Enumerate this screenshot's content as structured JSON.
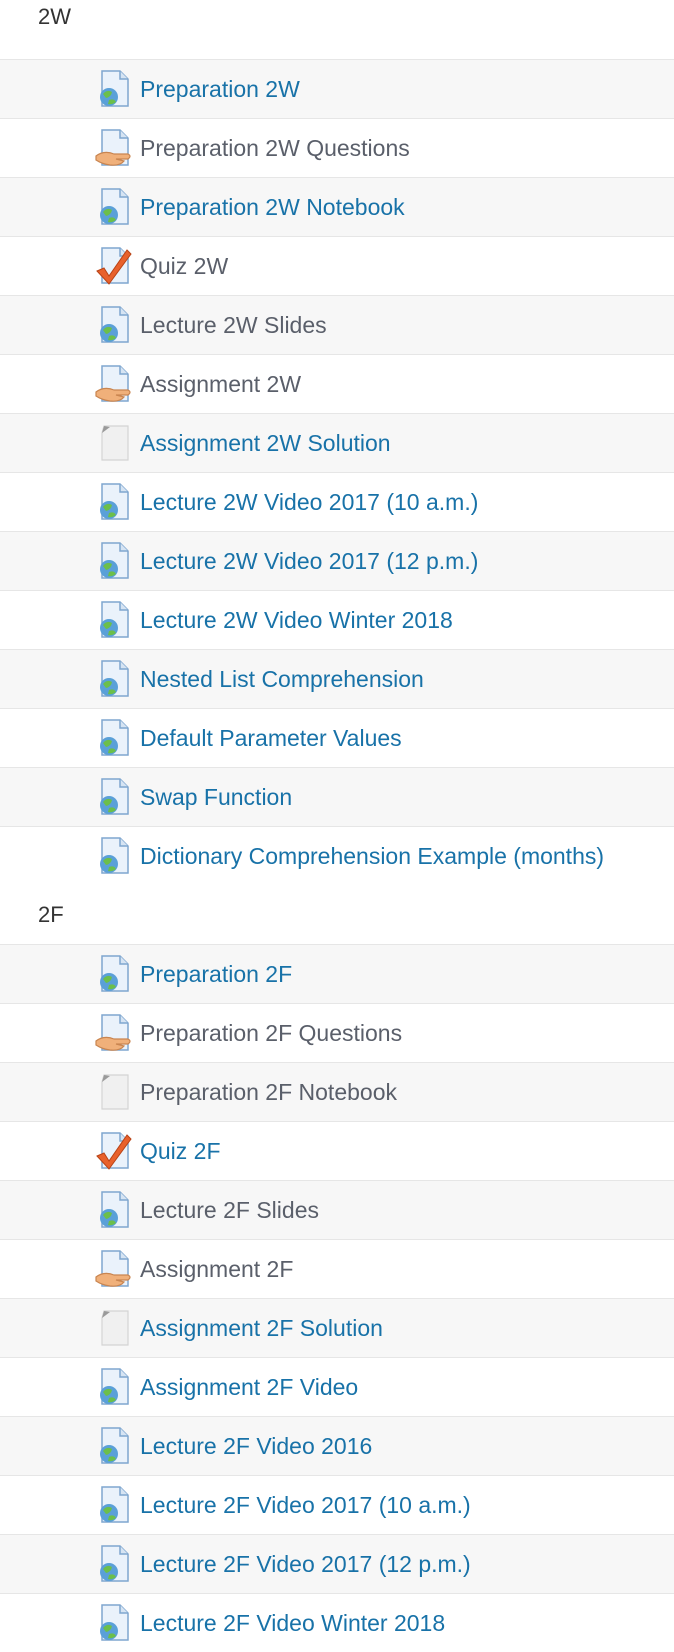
{
  "colors": {
    "link": "#1872a8",
    "muted": "#5a5f6a",
    "row_alt": "#f7f7f7"
  },
  "sections": [
    {
      "title": "2W",
      "items": [
        {
          "label": "Preparation 2W",
          "icon": "url-globe-icon",
          "style": "link"
        },
        {
          "label": "Preparation 2W Questions",
          "icon": "assignment-hand-icon",
          "style": "plain"
        },
        {
          "label": "Preparation 2W Notebook",
          "icon": "url-globe-icon",
          "style": "link"
        },
        {
          "label": "Quiz 2W",
          "icon": "quiz-check-icon",
          "style": "plain"
        },
        {
          "label": "Lecture 2W Slides",
          "icon": "url-globe-icon",
          "style": "plain"
        },
        {
          "label": "Assignment 2W",
          "icon": "assignment-hand-icon",
          "style": "plain"
        },
        {
          "label": "Assignment 2W Solution",
          "icon": "file-blank-icon",
          "style": "link"
        },
        {
          "label": "Lecture 2W Video 2017 (10 a.m.)",
          "icon": "url-globe-icon",
          "style": "link"
        },
        {
          "label": "Lecture 2W Video 2017 (12 p.m.)",
          "icon": "url-globe-icon",
          "style": "link"
        },
        {
          "label": "Lecture 2W Video Winter 2018",
          "icon": "url-globe-icon",
          "style": "link"
        },
        {
          "label": "Nested List Comprehension",
          "icon": "url-globe-icon",
          "style": "link"
        },
        {
          "label": "Default Parameter Values",
          "icon": "url-globe-icon",
          "style": "link"
        },
        {
          "label": "Swap Function",
          "icon": "url-globe-icon",
          "style": "link"
        },
        {
          "label": "Dictionary Comprehension Example (months)",
          "icon": "url-globe-icon",
          "style": "link"
        }
      ]
    },
    {
      "title": "2F",
      "items": [
        {
          "label": "Preparation 2F",
          "icon": "url-globe-icon",
          "style": "link"
        },
        {
          "label": "Preparation 2F Questions",
          "icon": "assignment-hand-icon",
          "style": "plain"
        },
        {
          "label": "Preparation 2F Notebook",
          "icon": "file-blank-icon",
          "style": "plain"
        },
        {
          "label": "Quiz 2F",
          "icon": "quiz-check-icon",
          "style": "link"
        },
        {
          "label": "Lecture 2F Slides",
          "icon": "url-globe-icon",
          "style": "plain"
        },
        {
          "label": "Assignment 2F",
          "icon": "assignment-hand-icon",
          "style": "plain"
        },
        {
          "label": "Assignment 2F Solution",
          "icon": "file-blank-icon",
          "style": "link"
        },
        {
          "label": "Assignment 2F Video",
          "icon": "url-globe-icon",
          "style": "link"
        },
        {
          "label": "Lecture 2F Video 2016",
          "icon": "url-globe-icon",
          "style": "link"
        },
        {
          "label": "Lecture 2F Video 2017 (10 a.m.)",
          "icon": "url-globe-icon",
          "style": "link"
        },
        {
          "label": "Lecture 2F Video 2017 (12 p.m.)",
          "icon": "url-globe-icon",
          "style": "link"
        },
        {
          "label": "Lecture 2F Video Winter 2018",
          "icon": "url-globe-icon",
          "style": "link"
        }
      ]
    }
  ]
}
